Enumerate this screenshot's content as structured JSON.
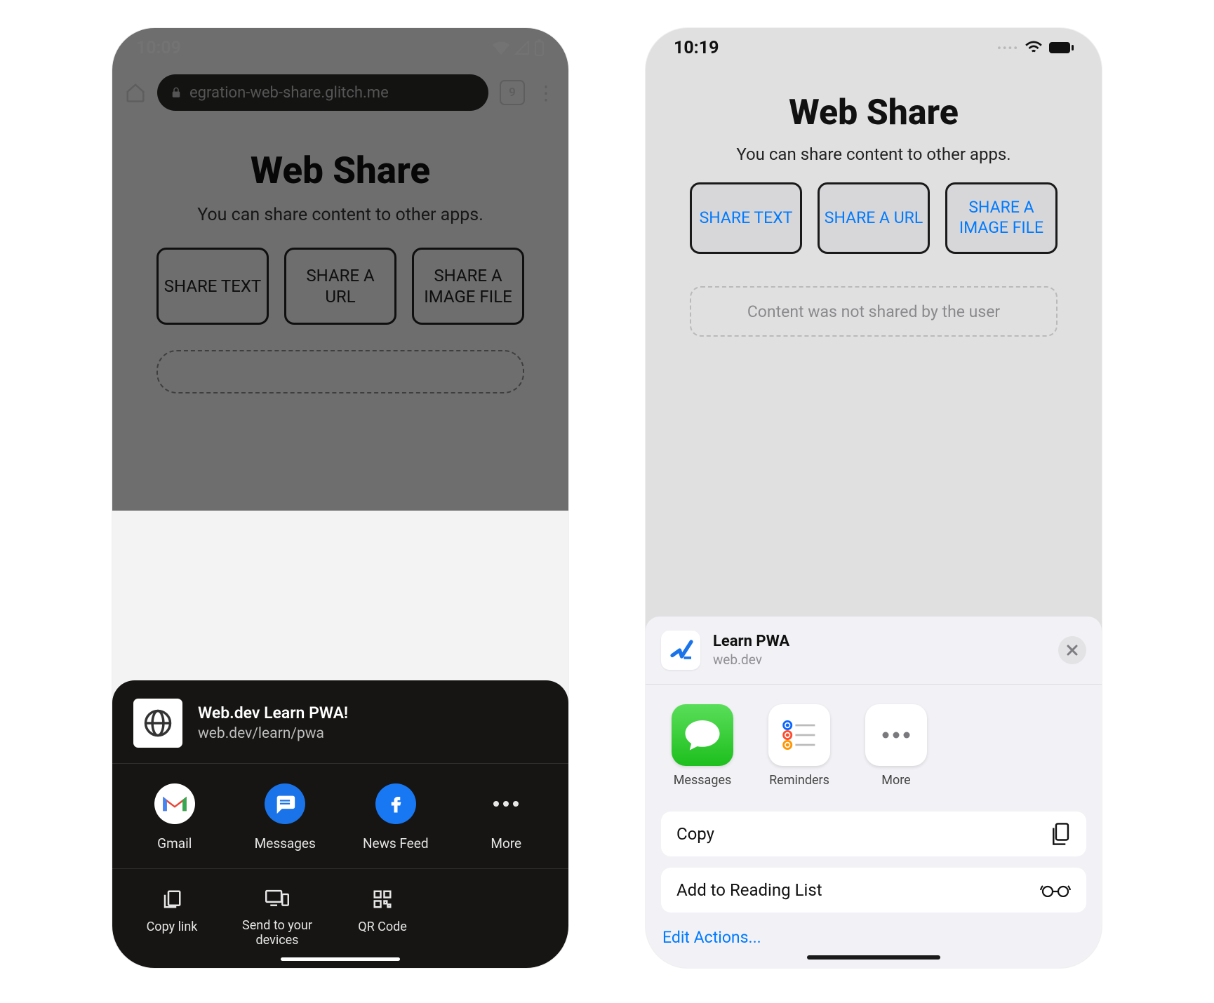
{
  "page": {
    "title": "Web Share",
    "subtitle": "You can share content to other apps.",
    "buttons": [
      "SHARE TEXT",
      "SHARE A URL",
      "SHARE A IMAGE FILE"
    ]
  },
  "android": {
    "status": {
      "time": "10:09"
    },
    "url": "egration-web-share.glitch.me",
    "tab_count": "9",
    "share": {
      "title": "Web.dev Learn PWA!",
      "url": "web.dev/learn/pwa",
      "apps": [
        "Gmail",
        "Messages",
        "News Feed",
        "More"
      ],
      "actions": [
        "Copy link",
        "Send to your devices",
        "QR Code"
      ]
    }
  },
  "ios": {
    "status": {
      "time": "10:19"
    },
    "result_text": "Content was not shared by the user",
    "share": {
      "title": "Learn PWA",
      "url": "web.dev",
      "apps": [
        "Messages",
        "Reminders",
        "More"
      ],
      "actions": [
        "Copy",
        "Add to Reading List"
      ],
      "edit": "Edit Actions..."
    }
  }
}
